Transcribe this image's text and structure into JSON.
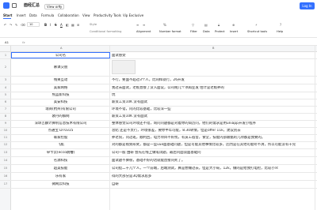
{
  "app": {
    "title": "面经汇总",
    "share_label": "View only",
    "login_label": "Log In",
    "accent": "#3370ff"
  },
  "menu": [
    "Start",
    "Insert",
    "Data",
    "Formula",
    "Collaboration",
    "View",
    "Productivity Tools",
    "Vip Exclusive"
  ],
  "toolbar": {
    "font_size": "10",
    "style_label": "Style",
    "cond_format_label": "Conditional formatting",
    "alignment_label": "Alignment",
    "number_format_label": "Number format",
    "filter_label": "Filter",
    "data_label": "Data",
    "protect_label": "Protect",
    "insert_label": "Insert",
    "shortcut_label": "Shortcut tools",
    "help_label": "Help"
  },
  "formula": {
    "cell_ref": "A1",
    "fx": "fx"
  },
  "grid": {
    "col_a": "A",
    "col_b": "B",
    "rows": [
      {
        "n": "1",
        "a": "公司名",
        "b": "面试感受"
      },
      {
        "n": "2",
        "a": "慕课交朋",
        "b": ""
      },
      {
        "n": "3",
        "a": "线果互动",
        "b": "不行，要面不超过3个人，比同样就行，26开发"
      },
      {
        "n": "4",
        "a": "美家网络",
        "b": "我过去面试，老板直接了没入面议，公司规几个项再业发 估计是老板养的"
      },
      {
        "n": "5",
        "a": "熊蓝新科技",
        "b": "坑"
      },
      {
        "n": "6",
        "a": "美安科技",
        "b": "薪资工资10K 没有面试"
      },
      {
        "n": "7",
        "a": "瑞商(杭州)有限公司",
        "b": "环境不错，问的比较基础，比较深一些"
      },
      {
        "n": "8",
        "a": "裴丹的群网",
        "b": "薪资工资10K 没有面试"
      },
      {
        "n": "9",
        "a": "深圳吉麟计算机信息技术有限公司",
        "b": "整体感觉公司环境还不错，询问问题都是对着你的简历问，他们的需求是用uniapp开发小程序"
      },
      {
        "n": "10",
        "a": "点通宝 DT0315",
        "b": "总结 还是不太行，环境很差，要你半年可能，8.30转情，但是offer 11k，建议别去"
      },
      {
        "n": "11",
        "a": "联家控股",
        "b": "养老院，问过班，顺利回，电力项目不好找，有员工宿舍，食堂，技能内部跟据的几项都是我要的。"
      },
      {
        "n": "12",
        "a": "飞肌",
        "b": "对的都是视频形式，都是一些vue面基础问题，但是可能其他事情比较多，因为是在其他可能听不清，所以可能没有干完"
      },
      {
        "n": "13",
        "a": "卓卡云(ecco跳槽)",
        "b": "公司一般 由研 会先在线上做笔试题，最后问面谈面基础问"
      },
      {
        "n": "14",
        "a": "名源科技",
        "b": "面试题不算很，基础不好的话就能直接问死了。"
      },
      {
        "n": "15",
        "a": "超美技能",
        "b": "公司挺二十几个人，一个前端，后端测试，算是想做过去，但是大小局，12k，做的是给我打电检，比较小众"
      },
      {
        "n": "16",
        "a": "乐有家",
        "b": "得的大部分是3Q需求居多"
      },
      {
        "n": "17",
        "a": "微网云科技",
        "b": "自研"
      }
    ]
  }
}
